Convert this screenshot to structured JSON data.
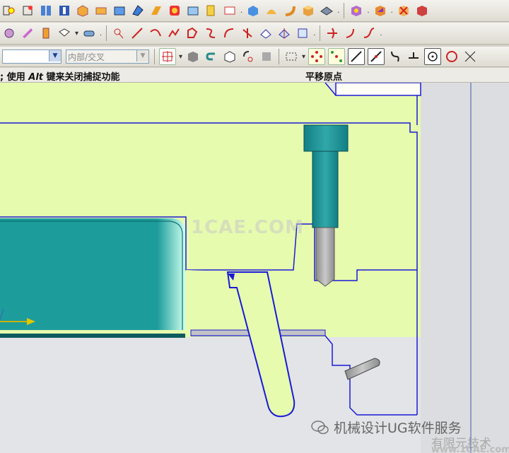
{
  "toolbar": {
    "row1_icons": [
      "sketch-icon",
      "point-icon",
      "book-icon",
      "book-blue-icon",
      "box-icon",
      "cylinder-icon",
      "block-icon",
      "sheet-icon",
      "feature-icon",
      "pad-icon",
      "slot-icon",
      "groove-icon",
      "edge-icon",
      "thread-icon",
      "wave-icon",
      "cube-icon",
      "blend-icon",
      "chamfer-icon",
      "shell-icon",
      "offset-icon",
      "pattern-icon",
      "color-cube-icon",
      "delete-body-icon"
    ],
    "row2_icons": [
      "gear-icon",
      "mirror-icon",
      "extract-icon",
      "draft-icon",
      "cylinder-gray-icon",
      "circle-line-icon",
      "line-icon",
      "arc-icon",
      "spline-icon",
      "polygon-icon",
      "trim-icon",
      "extend-icon",
      "fillet-2d-icon",
      "chamfer-2d-icon",
      "project-icon",
      "intersect-curve-icon",
      "offset-curve-icon",
      "bridge-icon"
    ]
  },
  "selection_bar": {
    "filter_value": "",
    "intersect_value": "内部/交叉",
    "snap_icons": [
      "snap-endpoint-icon",
      "snap-midpoint-icon",
      "snap-control-icon",
      "snap-intersect-icon",
      "snap-center-icon",
      "snap-quadrant-icon",
      "snap-point-on-curve-icon"
    ]
  },
  "status": {
    "prompt_prefix": "; 使用",
    "prompt_key": "Alt",
    "prompt_suffix": "键来关闭捕捉功能",
    "right_text": "平移原点"
  },
  "watermarks": {
    "site": "1CAE.COM",
    "wechat": "机械设计UG软件服务",
    "partner": "有限元技术",
    "partner_site": "www.1CAE.com"
  },
  "colors": {
    "mold_fill": "#e6fbae",
    "outline": "#1a1ad6",
    "slider": "#1d9c9c",
    "pin_gray": "#a7a7a7"
  }
}
